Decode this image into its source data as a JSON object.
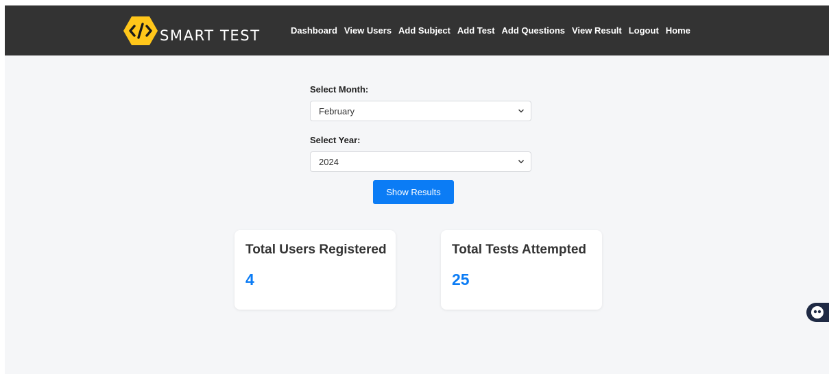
{
  "brand": {
    "name": "SMART TEST",
    "badge_color": "#ffc61a"
  },
  "nav": {
    "items": [
      {
        "label": "Dashboard"
      },
      {
        "label": "View Users"
      },
      {
        "label": "Add Subject"
      },
      {
        "label": "Add Test"
      },
      {
        "label": "Add Questions"
      },
      {
        "label": "View Result"
      },
      {
        "label": "Logout"
      },
      {
        "label": "Home"
      }
    ]
  },
  "filters": {
    "month": {
      "label": "Select Month:",
      "value": "February"
    },
    "year": {
      "label": "Select Year:",
      "value": "2024"
    },
    "submit_label": "Show Results"
  },
  "stats": [
    {
      "title": "Total Users Registered",
      "value": "4"
    },
    {
      "title": "Total Tests Attempted",
      "value": "25"
    }
  ],
  "colors": {
    "navbar": "#333333",
    "accent": "#0b7cf5",
    "background": "#f5f6f8"
  },
  "icons": {
    "logo": "code-brackets-icon",
    "chat": "chat-bot-icon"
  }
}
